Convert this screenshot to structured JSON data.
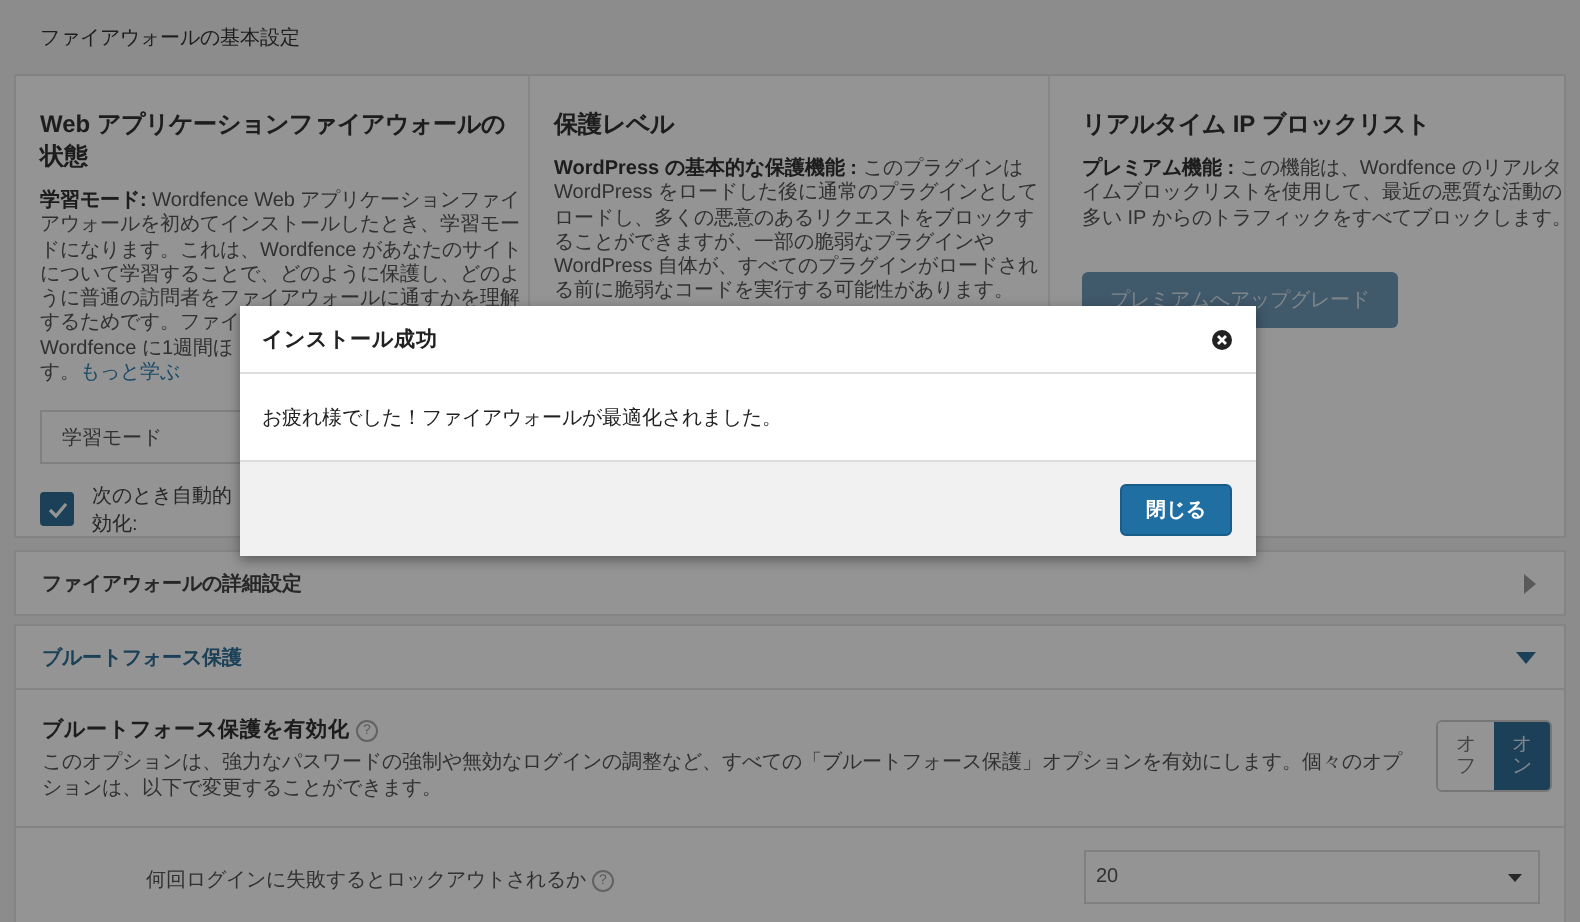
{
  "page_header": "ファイアウォールの基本設定",
  "columns": [
    {
      "title": "Web アプリケーションファイアウォールの状態",
      "lines": [
        "**学習モード:** Wordfence Web アプリケーションファイ",
        "アウォールを初めてインストールしたとき、学習モー",
        "ドになります。これは、Wordfence があなたのサイト",
        "について学習することで、どのように保護し、どのよ",
        "うに普通の訪問者をファイアウォールに通すかを理解",
        "するためです。ファイ",
        "Wordfence に1週間ほ",
        "す。"
      ],
      "link": "もっと学ぶ",
      "select": {
        "value": "学習モード"
      },
      "checkbox": {
        "checked": true,
        "lines": [
          "次のとき自動的",
          "効化:"
        ]
      }
    },
    {
      "title": "保護レベル",
      "lines": [
        "**WordPress の基本的な保護機能 :** このプラグインは",
        "WordPress をロードした後に通常のプラグインとして",
        "ロードし、多くの悪意のあるリクエストをブロックす",
        "ることができますが、一部の脆弱なプラグインや",
        "WordPress 自体が、すべてのプラグインがロードされ",
        "る前に脆弱なコードを実行する可能性があります。"
      ]
    },
    {
      "title": "リアルタイム IP ブロックリスト",
      "lines": [
        "**プレミアム機能 :** この機能は、Wordfence のリアルタ",
        "イムブロックリストを使用して、最近の悪質な活動の",
        "多い IP からのトラフィックをすべてブロックします。"
      ],
      "button": "プレミアムへアップグレード"
    }
  ],
  "sections": [
    {
      "title": "ファイアウォールの詳細設定",
      "expanded": false
    },
    {
      "title": "ブルートフォース保護",
      "expanded": true
    }
  ],
  "option": {
    "title": "ブルートフォース保護を有効化",
    "help": "?",
    "description": "このオプションは、強力なパスワードの強制や無効なログインの調整など、すべての「ブルートフォース保護」オプションを有効にします。個々のオプションは、以下で変更することができます。",
    "toggle": [
      {
        "label": "オフ",
        "selected": false
      },
      {
        "label": "オン",
        "selected": true
      }
    ]
  },
  "setting": {
    "label": "何回ログインに失敗するとロックアウトされるか",
    "help": "?",
    "value": "20"
  },
  "modal": {
    "title": "インストール成功",
    "message": "お疲れ様でした！ファイアウォールが最適化されました。",
    "button": "閉じる"
  }
}
